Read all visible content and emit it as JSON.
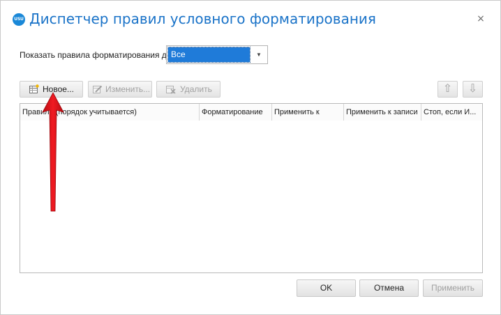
{
  "window": {
    "title": "Диспетчер правил условного форматирования",
    "app_icon_text": "USU",
    "close_glyph": "×"
  },
  "filter": {
    "label": "Показать правила форматирования для:",
    "selected": "Все",
    "dropdown_glyph": "▼"
  },
  "toolbar": {
    "new_label": "Новое...",
    "edit_label": "Изменить...",
    "delete_label": "Удалить",
    "move_up_glyph": "⇧",
    "move_down_glyph": "⇩"
  },
  "grid": {
    "columns": [
      "Правило (порядок учитывается)",
      "Форматирование",
      "Применить к",
      "Применить к записи",
      "Стоп, если И..."
    ],
    "rows": []
  },
  "footer": {
    "ok_label": "OK",
    "cancel_label": "Отмена",
    "apply_label": "Применить"
  },
  "colors": {
    "accent": "#1a73c8",
    "selection": "#1f7bd9",
    "annotation_arrow": "#e8131b"
  }
}
